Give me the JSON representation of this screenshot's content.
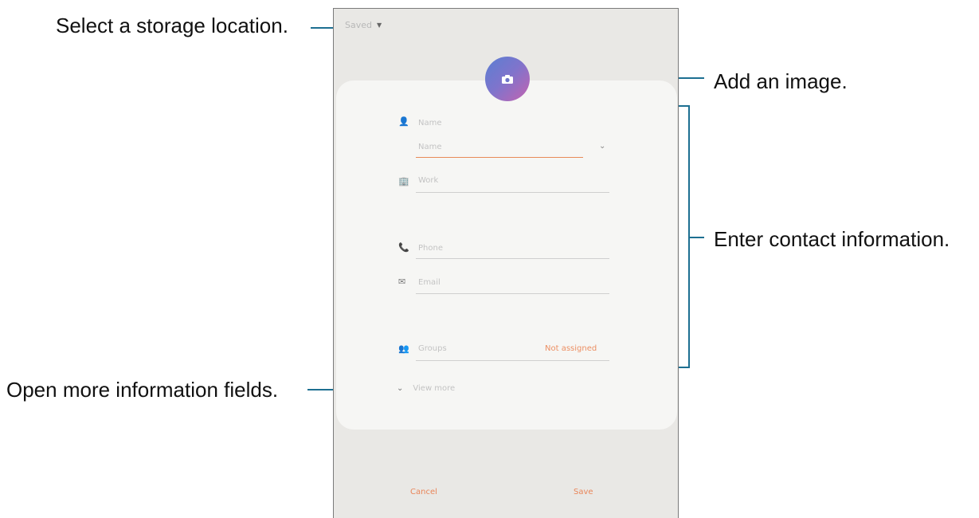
{
  "callouts": {
    "storage": "Select a storage location.",
    "image": "Add an image.",
    "contact": "Enter contact information.",
    "more": "Open more information fields."
  },
  "form": {
    "storage_label": "Saved",
    "name_section": "Name",
    "name_placeholder": "Name",
    "work_label": "Work",
    "phone_label": "Phone",
    "email_label": "Email",
    "groups_label": "Groups",
    "groups_value": "Not assigned",
    "view_more_label": "View more",
    "cancel_label": "Cancel",
    "save_label": "Save"
  },
  "icons": {
    "storage_dropdown": "chevron-down-icon",
    "photo": "camera-icon",
    "name": "person-icon",
    "work": "building-icon",
    "phone": "phone-icon",
    "email": "mail-icon",
    "groups": "group-icon",
    "view_more": "chevron-down-icon",
    "name_expand": "chevron-down-icon"
  },
  "colors": {
    "accent": "#e9865a",
    "photo_gradient_start": "#5a7fd2",
    "photo_gradient_end": "#c463b0",
    "callout_line": "#1d6f91",
    "screen_bg": "#e9e8e5",
    "card_bg": "#f6f6f4"
  }
}
